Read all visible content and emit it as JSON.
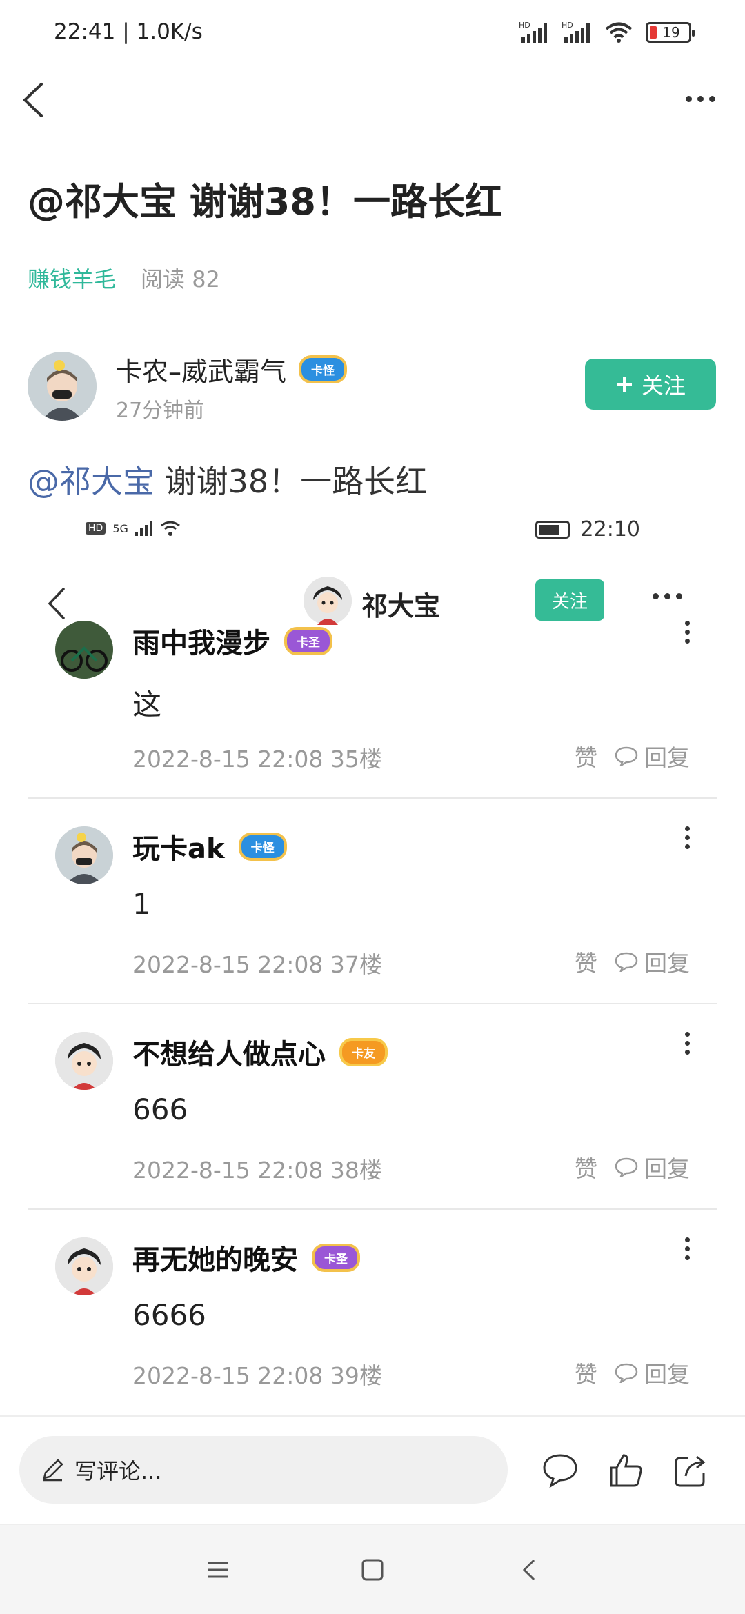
{
  "status_bar": {
    "time": "22:41 | 1.0K/s",
    "battery": "19",
    "signal_labels": [
      "HD",
      "HD"
    ]
  },
  "post": {
    "title": "@祁大宝 谢谢38！一路长红",
    "category": "赚钱羊毛",
    "reads": "阅读 82",
    "author": {
      "name": "卡农–威武霸气",
      "badge": "卡怪",
      "time": "27分钟前"
    },
    "follow_label": "关注",
    "body_mention": "@祁大宝",
    "body_text": " 谢谢38！一路长红"
  },
  "embedded": {
    "status_time": "22:10",
    "status_left": [
      "HD",
      "5G"
    ],
    "header_name": "祁大宝",
    "follow_label": "关注",
    "comments": [
      {
        "name": "雨中我漫步",
        "badge": "卡圣",
        "badge_color": "purple",
        "text": "这",
        "date": "2022-8-15 22:08",
        "floor": "35楼",
        "like": "赞",
        "reply": "回复"
      },
      {
        "name": "玩卡ak",
        "badge": "卡怪",
        "badge_color": "blue",
        "text": "1",
        "date": "2022-8-15 22:08",
        "floor": "37楼",
        "like": "赞",
        "reply": "回复"
      },
      {
        "name": "不想给人做点心",
        "badge": "卡友",
        "badge_color": "orange",
        "text": "666",
        "date": "2022-8-15 22:08",
        "floor": "38楼",
        "like": "赞",
        "reply": "回复"
      },
      {
        "name": "再无她的晚安",
        "badge": "卡圣",
        "badge_color": "purple",
        "text": "6666",
        "date": "2022-8-15 22:08",
        "floor": "39楼",
        "like": "赞",
        "reply": "回复"
      }
    ]
  },
  "bottom": {
    "comment_placeholder": "写评论..."
  },
  "colors": {
    "accent": "#35bb96",
    "category": "#2fb89a",
    "mention": "#4a69a8"
  }
}
